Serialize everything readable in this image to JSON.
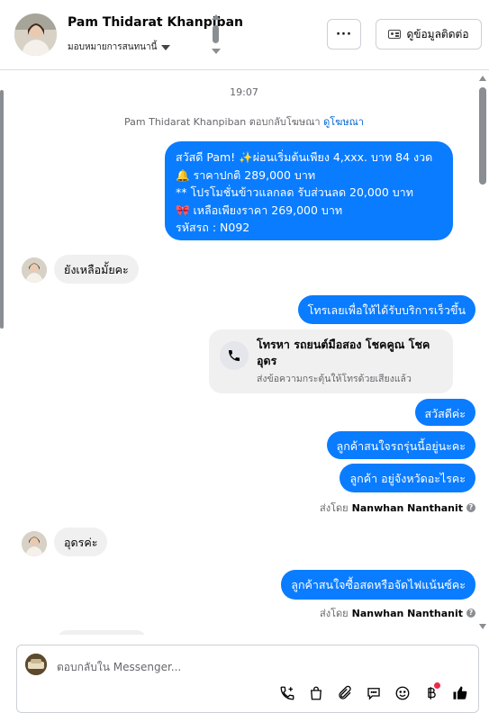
{
  "header": {
    "contact_name": "Pam Thidarat Khanpiban",
    "assign_label": "มอบหมายการสนทนานี้",
    "more_label": "···",
    "contact_info_label": "ดูข้อมูลติดต่อ"
  },
  "conversation": {
    "timestamp": "19:07",
    "ad_reply_text": "Pam Thidarat Khanpiban ตอบกลับโฆษณา",
    "ad_link": "ดูโฆษณา",
    "promo_lines": [
      "สวัสดี Pam! ✨ผ่อนเริ่มต้นเพียง 4,xxx. บาท 84 งวด",
      "🔔 ราคาปกติ  289,000 บาท",
      "** โปรโมชั่นข้าวแลกลด รับส่วนลด 20,000 บาท",
      "🎀  เหลือเพียงราคา 269,000 บาท",
      " รหัสรถ : N092"
    ],
    "incoming_1": "ยังเหลือมั้ยคะ",
    "outgoing_call_prompt": "โทรเลยเพื่อให้ได้รับบริการเร็วขึ้น",
    "call_card": {
      "title": "โทรหา รถยนต์มือสอง โชคคูณ โชค อุดร",
      "subtitle": "ส่งข้อความกระตุ้นให้โทรด้วยเสียงแล้ว"
    },
    "outgoing_hello": "สวัสดีค่ะ",
    "outgoing_q1": "ลูกค้าสนใจรถรุ่นนี้อยู่นะคะ",
    "outgoing_q2": "ลูกค้า อยู่จังหวัดอะไรคะ",
    "sent_by_prefix": "ส่งโดย",
    "sent_by_name": "Nanwhan Nanthanit",
    "incoming_2": "อุดรค่ะ",
    "outgoing_q3": "ลูกค้าสนใจซื้อสดหรือจัดไฟแน้นซ์คะ"
  },
  "composer": {
    "placeholder": "ตอบกลับใน Messenger..."
  },
  "icons": {
    "tools": [
      "phone-plus-icon",
      "shopping-bag-icon",
      "paperclip-icon",
      "chat-bubble-icon",
      "emoji-icon",
      "baht-icon",
      "thumbs-up-icon"
    ]
  },
  "colors": {
    "accent": "#0a7cff",
    "incoming_bubble": "#f0f0f0",
    "notification_dot": "#f02849"
  }
}
